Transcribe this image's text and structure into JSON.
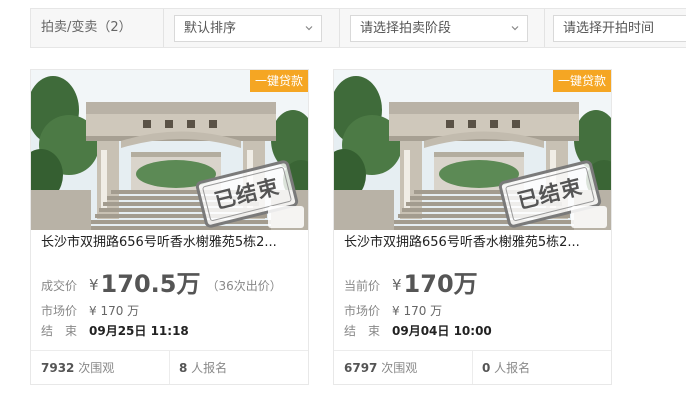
{
  "filter": {
    "label": "拍卖/变卖",
    "count": "（2）",
    "sort_select": "默认排序",
    "stage_select": "请选择拍卖阶段",
    "time_select": "请选择开拍时间"
  },
  "cards": [
    {
      "badge": "一键贷款",
      "stamp": "已结束",
      "title": "长沙市双拥路656号听香水榭雅苑5栋2...",
      "price_label": "成交价",
      "currency": "¥",
      "price": "170.5万",
      "bids": "（36次出价）",
      "market_label": "市场价",
      "market_value": "¥ 170 万",
      "end_label": "结　束",
      "end_value": "09月25日 11:18",
      "views_num": "7932",
      "views_text": " 次围观",
      "signup_num": "8",
      "signup_text": " 人报名"
    },
    {
      "badge": "一键贷款",
      "stamp": "已结束",
      "title": "长沙市双拥路656号听香水榭雅苑5栋2...",
      "price_label": "当前价",
      "currency": "¥",
      "price": "170万",
      "bids": "",
      "market_label": "市场价",
      "market_value": "¥ 170 万",
      "end_label": "结　束",
      "end_value": "09月04日 10:00",
      "views_num": "6797",
      "views_text": " 次围观",
      "signup_num": "0",
      "signup_text": " 人报名"
    }
  ],
  "colors": {
    "badge": "#f5a623",
    "filter_bg": "#f7f7f7"
  }
}
